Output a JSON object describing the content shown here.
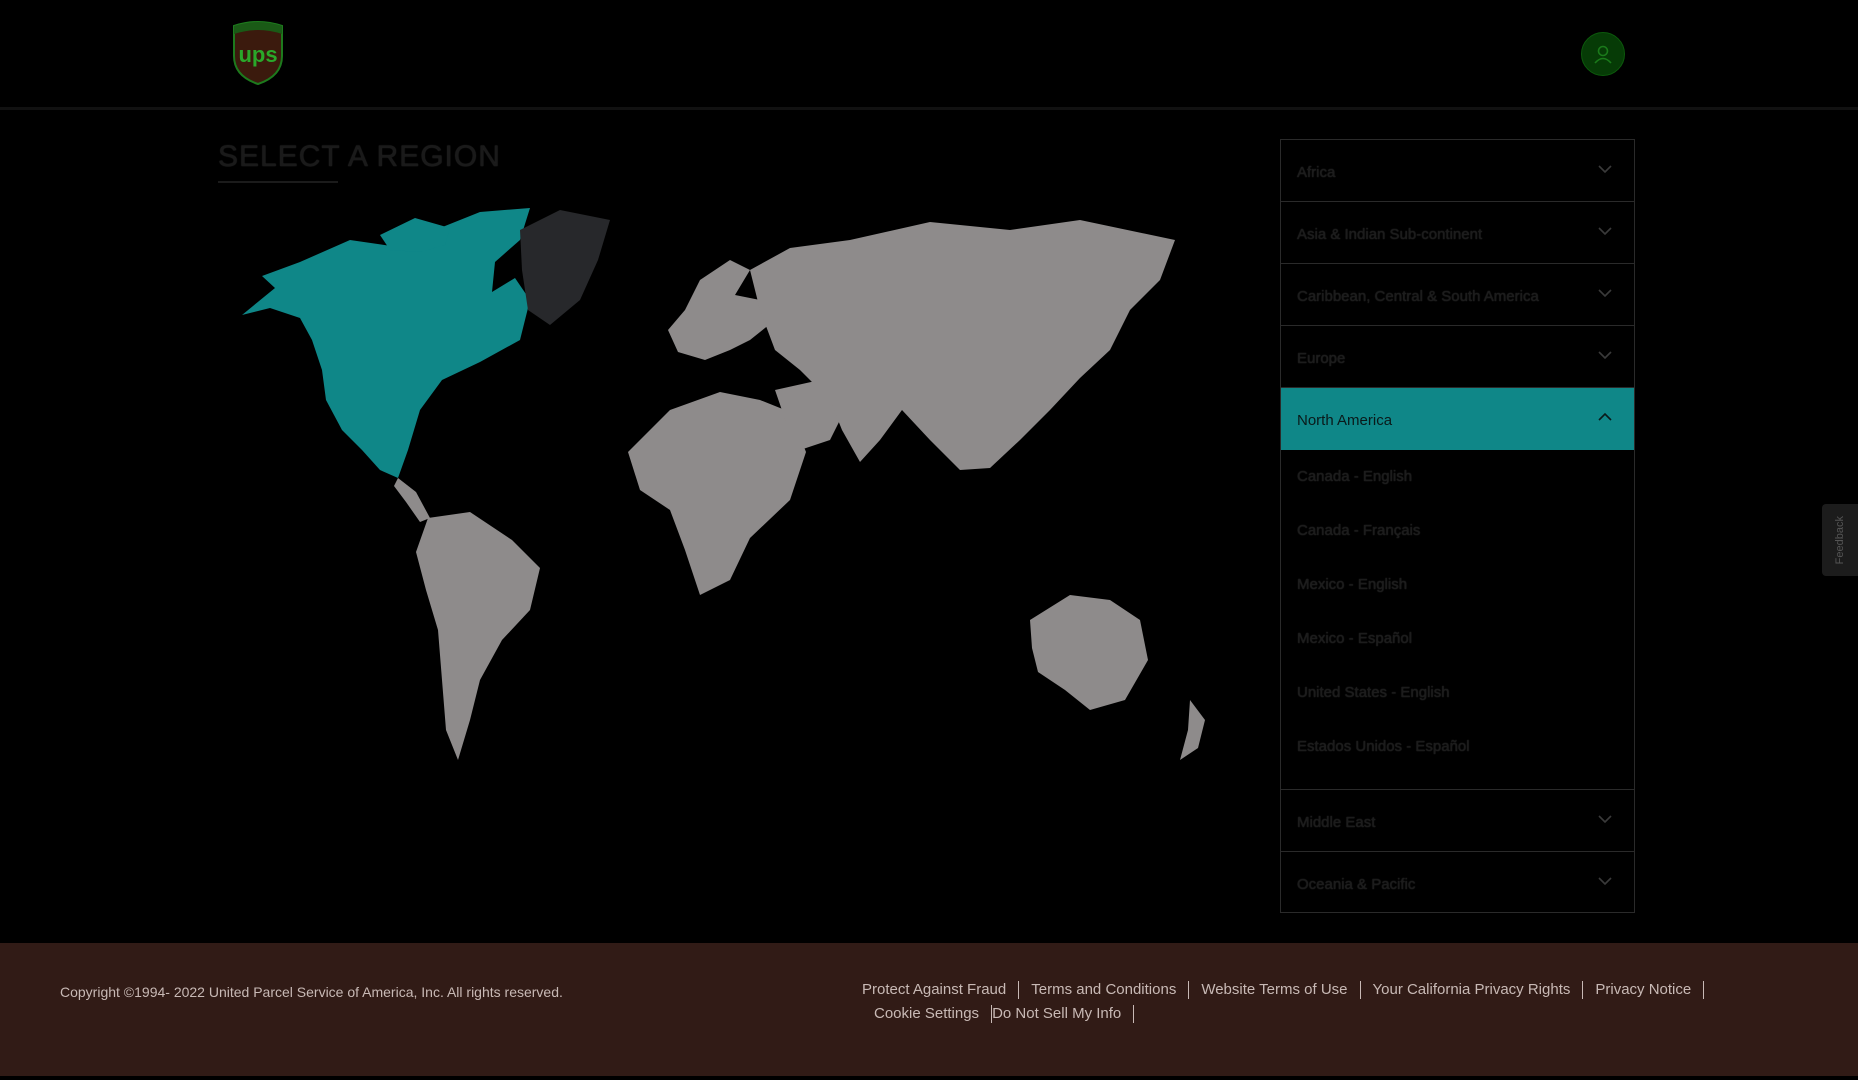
{
  "header": {
    "logo_alt": "ups",
    "profile_icon": "user-icon"
  },
  "page": {
    "title": "SELECT A REGION"
  },
  "colors": {
    "accent": "#0f8788",
    "background": "#000000",
    "map_land": "#8e8b8b",
    "map_selected": "#0f8788",
    "map_greenland": "#27282b",
    "footer_bg": "#311b16"
  },
  "map": {
    "selected_region": "North America"
  },
  "regions": [
    {
      "label": "Africa",
      "expanded": false
    },
    {
      "label": "Asia & Indian Sub-continent",
      "expanded": false
    },
    {
      "label": "Caribbean, Central & South America",
      "expanded": false
    },
    {
      "label": "Europe",
      "expanded": false
    },
    {
      "label": "North America",
      "expanded": true,
      "links": [
        "Canada - English",
        "Canada - Français",
        "Mexico - English",
        "Mexico - Español",
        "United States - English",
        "Estados Unidos - Español"
      ]
    },
    {
      "label": "Middle East",
      "expanded": false
    },
    {
      "label": "Oceania & Pacific",
      "expanded": false
    }
  ],
  "feedback": {
    "label": "Feedback"
  },
  "footer": {
    "copyright": "Copyright ©1994- 2022  United Parcel Service of America, Inc. All rights reserved.",
    "links": [
      "Protect Against Fraud",
      "Terms and Conditions",
      "Website Terms of Use",
      "Your California Privacy Rights",
      "Privacy Notice",
      "Cookie Settings",
      "Do Not Sell My Info"
    ]
  }
}
